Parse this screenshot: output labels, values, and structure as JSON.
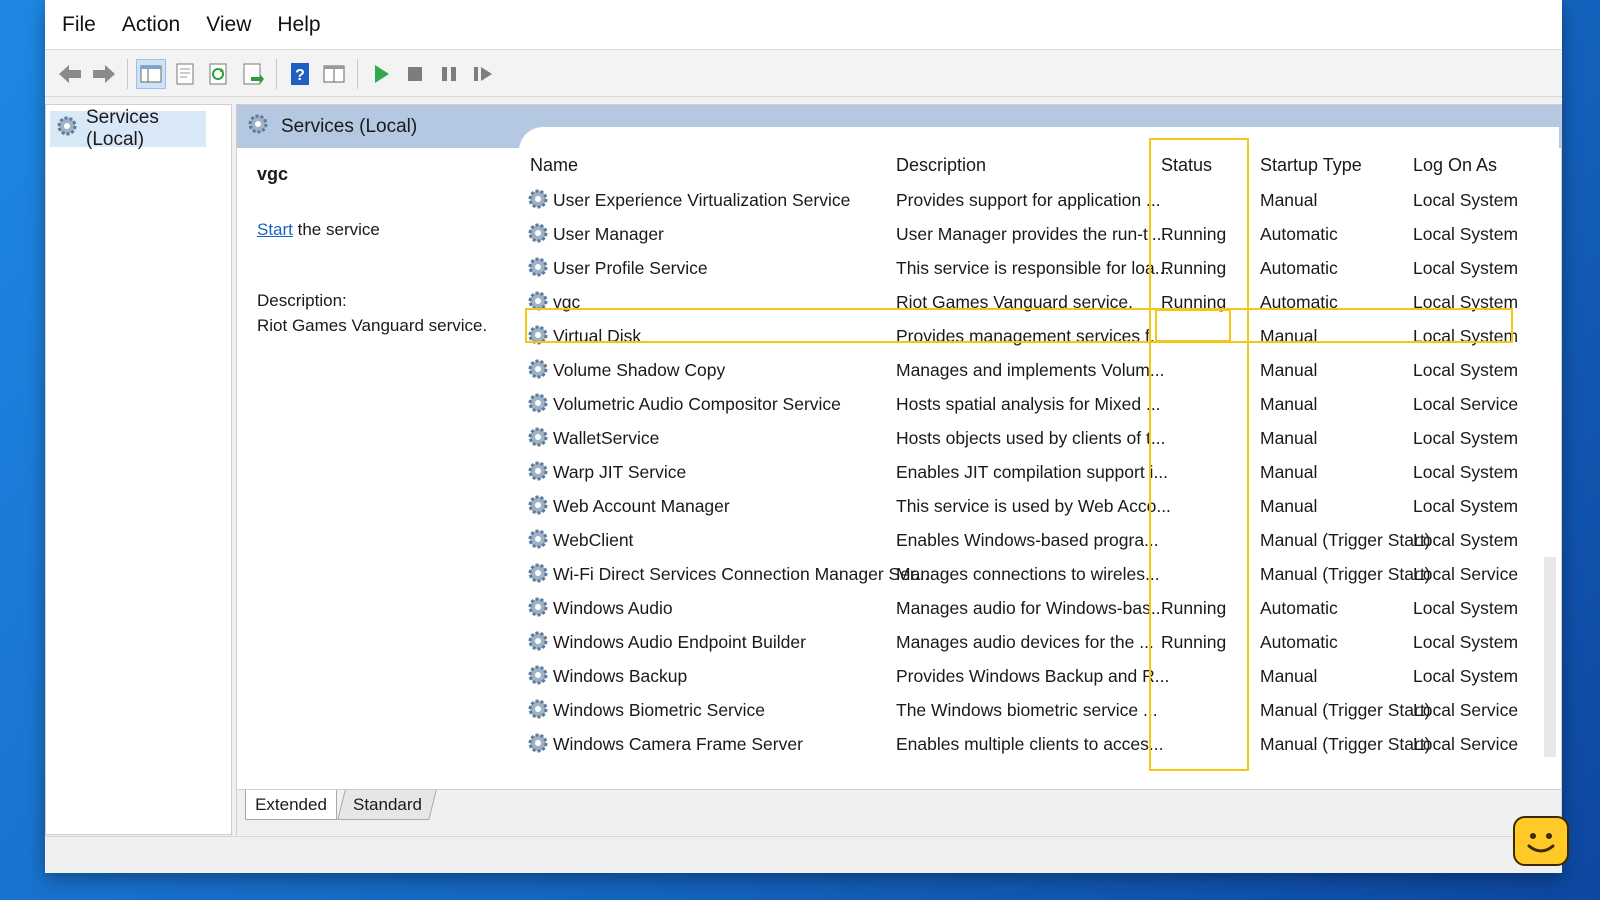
{
  "menu": [
    "File",
    "Action",
    "View",
    "Help"
  ],
  "toolbar": {
    "icons": [
      "back-icon",
      "forward-icon",
      "show-hide-tree-icon",
      "properties-icon",
      "refresh-icon",
      "export-list-icon",
      "help-icon",
      "view-icon",
      "start-service-icon",
      "stop-service-icon",
      "pause-service-icon",
      "resume-service-icon"
    ]
  },
  "tree": {
    "root_label": "Services (Local)"
  },
  "main": {
    "header_label": "Services (Local)",
    "selected_name": "vgc",
    "start_link": "Start",
    "start_suffix": " the service",
    "description_label": "Description:",
    "description_text": "Riot Games Vanguard service."
  },
  "columns": [
    "Name",
    "Description",
    "Status",
    "Startup Type",
    "Log On As"
  ],
  "services": [
    {
      "name": "User Experience Virtualization Service",
      "description": "Provides support for application ...",
      "status": "",
      "startup": "Manual",
      "logon": "Local System"
    },
    {
      "name": "User Manager",
      "description": "User Manager provides the run-ti...",
      "status": "Running",
      "startup": "Automatic",
      "logon": "Local System"
    },
    {
      "name": "User Profile Service",
      "description": "This service is responsible for loa...",
      "status": "Running",
      "startup": "Automatic",
      "logon": "Local System"
    },
    {
      "name": "vgc",
      "description": "Riot Games Vanguard service.",
      "status": "Running",
      "startup": "Automatic",
      "logon": "Local System"
    },
    {
      "name": "Virtual Disk",
      "description": "Provides management services f...",
      "status": "",
      "startup": "Manual",
      "logon": "Local System"
    },
    {
      "name": "Volume Shadow Copy",
      "description": "Manages and implements Volum...",
      "status": "",
      "startup": "Manual",
      "logon": "Local System"
    },
    {
      "name": "Volumetric Audio Compositor Service",
      "description": "Hosts spatial analysis for Mixed ...",
      "status": "",
      "startup": "Manual",
      "logon": "Local Service"
    },
    {
      "name": "WalletService",
      "description": "Hosts objects used by clients of t...",
      "status": "",
      "startup": "Manual",
      "logon": "Local System"
    },
    {
      "name": "Warp JIT Service",
      "description": "Enables JIT compilation support i...",
      "status": "",
      "startup": "Manual",
      "logon": "Local System"
    },
    {
      "name": "Web Account Manager",
      "description": "This service is used by Web Acco...",
      "status": "",
      "startup": "Manual",
      "logon": "Local System"
    },
    {
      "name": "WebClient",
      "description": "Enables Windows-based progra...",
      "status": "",
      "startup": "Manual (Trigger Start)",
      "logon": "Local System"
    },
    {
      "name": "Wi-Fi Direct Services Connection Manager Ser...",
      "description": "Manages connections to wireles...",
      "status": "",
      "startup": "Manual (Trigger Start)",
      "logon": "Local Service"
    },
    {
      "name": "Windows Audio",
      "description": "Manages audio for Windows-bas...",
      "status": "Running",
      "startup": "Automatic",
      "logon": "Local System"
    },
    {
      "name": "Windows Audio Endpoint Builder",
      "description": "Manages audio devices for the ...",
      "status": "Running",
      "startup": "Automatic",
      "logon": "Local System"
    },
    {
      "name": "Windows Backup",
      "description": "Provides Windows Backup and R...",
      "status": "",
      "startup": "Manual",
      "logon": "Local System"
    },
    {
      "name": "Windows Biometric Service",
      "description": "The Windows biometric service ...",
      "status": "",
      "startup": "Manual (Trigger Start)",
      "logon": "Local Service"
    },
    {
      "name": "Windows Camera Frame Server",
      "description": "Enables multiple clients to acces...",
      "status": "",
      "startup": "Manual (Trigger Start)",
      "logon": "Local Service"
    }
  ],
  "tabs": [
    "Extended",
    "Standard"
  ],
  "colors": {
    "highlight": "#f5c518",
    "header_band": "#b4c8e1",
    "link": "#1565c0"
  }
}
